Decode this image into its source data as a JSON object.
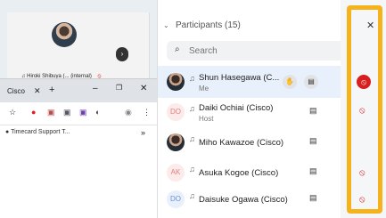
{
  "video": {
    "name": "Hiroki Shibuya (... (internal)",
    "next_icon": "›"
  },
  "browser": {
    "tab_label": "Cisco",
    "tab_close": "✕",
    "tab_plus": "+",
    "win_min": "–",
    "win_max": "❐",
    "win_close": "✕",
    "bookmark": "Timecard Support T...",
    "bookmark_more": "»"
  },
  "panel": {
    "title": "Participants (15)",
    "chevron": "⌄",
    "close": "✕",
    "search_placeholder": "Search",
    "participants": [
      {
        "initials": "",
        "name": "Shun Hasegawa (C...",
        "role": "Me"
      },
      {
        "initials": "DO",
        "name": "Daiki Ochiai (Cisco)",
        "role": "Host"
      },
      {
        "initials": "",
        "name": "Miho Kawazoe (Cisco)",
        "role": ""
      },
      {
        "initials": "AK",
        "name": "Asuka Kogoe (Cisco)",
        "role": ""
      },
      {
        "initials": "DO",
        "name": "Daisuke Ogawa (Cisco)",
        "role": ""
      }
    ]
  },
  "colors": {
    "highlight": "#f5b21b",
    "mute_red": "#d71f1f",
    "selected_row": "#e7f0fb"
  },
  "icons": {
    "headset": "headset-icon",
    "mic_muted": "mic-muted-icon",
    "cc": "closed-caption-icon",
    "raise_hand": "raise-hand-icon"
  }
}
